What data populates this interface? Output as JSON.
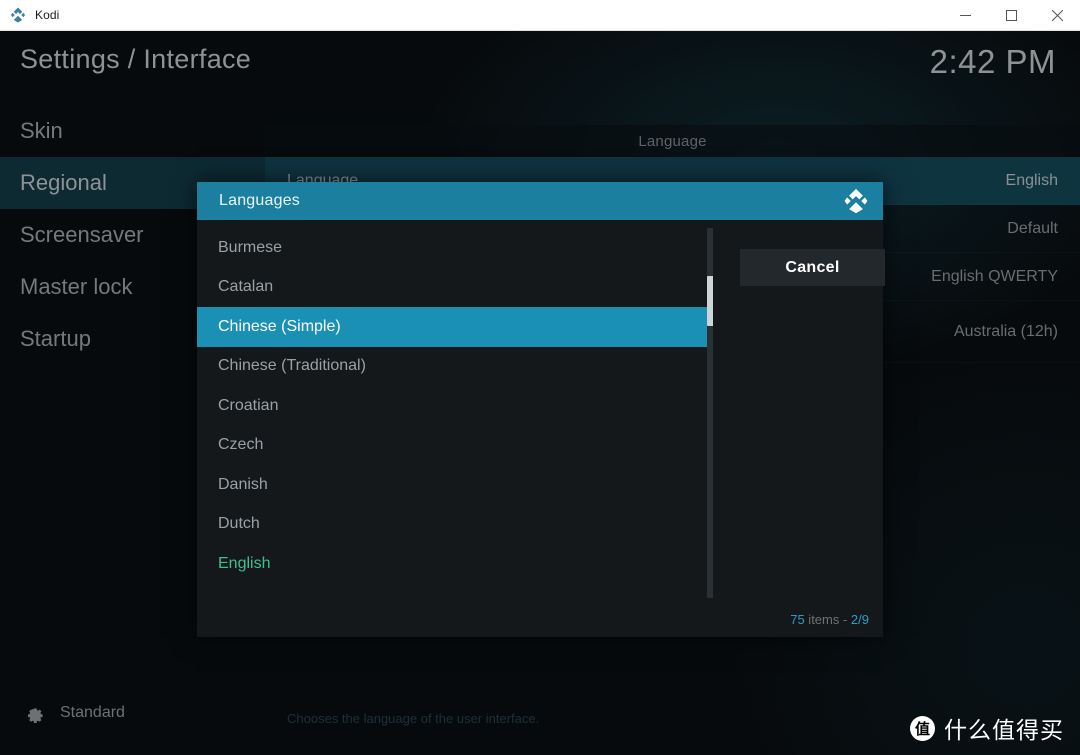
{
  "window": {
    "app_name": "Kodi",
    "logo_icon": "kodi-logo-icon",
    "minimize_label": "minimize-icon",
    "maximize_label": "maximize-icon",
    "close_label": "close-icon"
  },
  "header": {
    "title": "Settings / Interface",
    "clock": "2:42 PM"
  },
  "sidebar": {
    "items": [
      {
        "label": "Skin",
        "active": false
      },
      {
        "label": "Regional",
        "active": true
      },
      {
        "label": "Screensaver",
        "active": false
      },
      {
        "label": "Master lock",
        "active": false
      },
      {
        "label": "Startup",
        "active": false
      }
    ],
    "profile": {
      "icon": "gear-icon",
      "label": "Standard"
    }
  },
  "panel": {
    "section_title": "Language",
    "rows": [
      {
        "label": "Language",
        "value": "English",
        "selected": true
      },
      {
        "label": "",
        "value": "Default",
        "selected": false
      },
      {
        "label": "",
        "value": "English QWERTY",
        "selected": false
      },
      {
        "label": "",
        "value": "Australia (12h)",
        "selected": false
      }
    ],
    "description": "Chooses the language of the user interface."
  },
  "dialog": {
    "title": "Languages",
    "logo_icon": "kodi-logo-icon",
    "cancel_label": "Cancel",
    "items_count_prefix": "75",
    "items_count_mid": " items - ",
    "items_count_page": "2/9",
    "languages": [
      {
        "label": "Burmese",
        "state": "normal"
      },
      {
        "label": "Catalan",
        "state": "normal"
      },
      {
        "label": "Chinese (Simple)",
        "state": "selected"
      },
      {
        "label": "Chinese (Traditional)",
        "state": "normal"
      },
      {
        "label": "Croatian",
        "state": "normal"
      },
      {
        "label": "Czech",
        "state": "normal"
      },
      {
        "label": "Danish",
        "state": "normal"
      },
      {
        "label": "Dutch",
        "state": "normal"
      },
      {
        "label": "English",
        "state": "current"
      }
    ]
  },
  "watermark": {
    "badge": "值",
    "text": "什么值得买"
  },
  "colors": {
    "accent_teal": "#1b7fa0",
    "highlight_blue": "#1b90b5",
    "current_green": "#3fbf8c",
    "row_selected": "#0e3440"
  }
}
